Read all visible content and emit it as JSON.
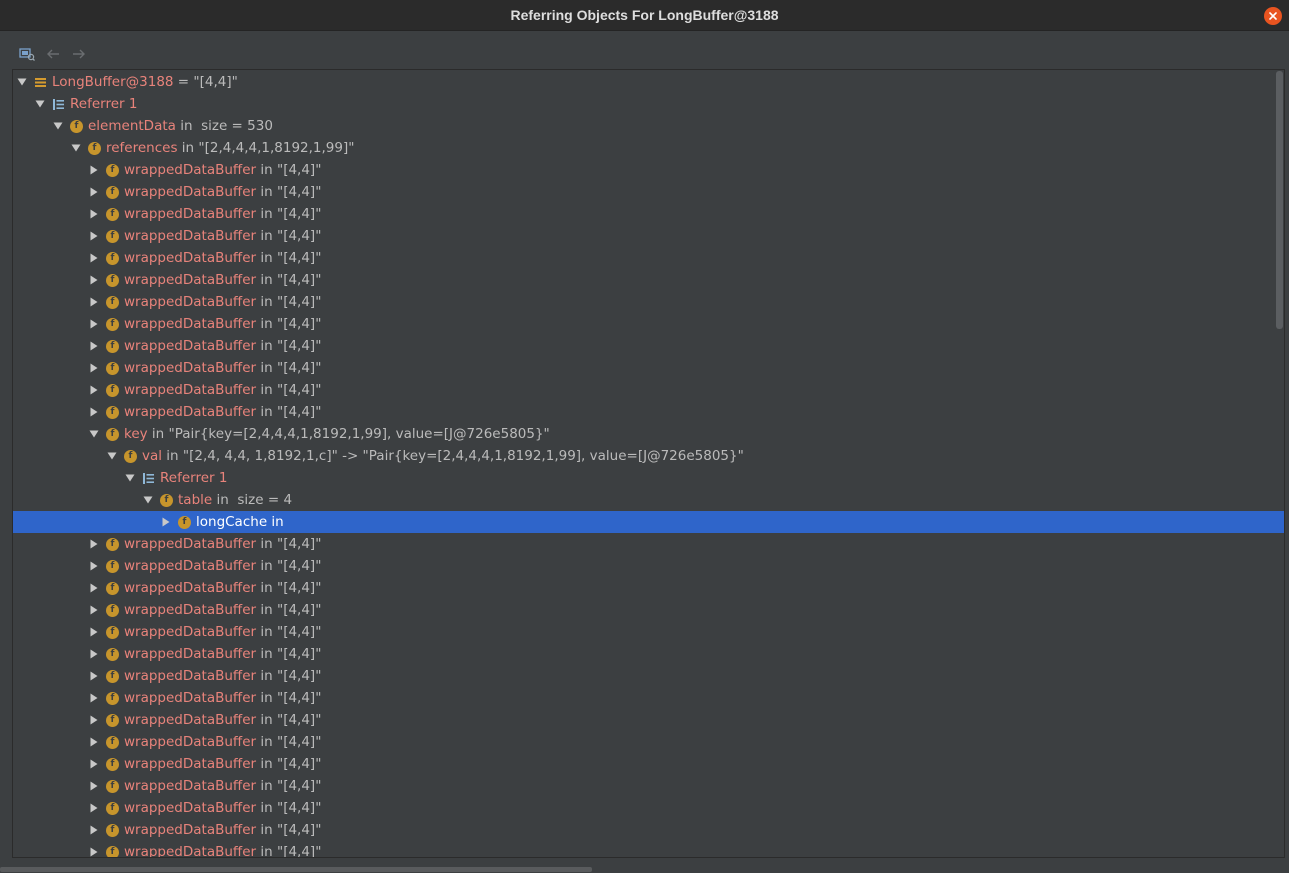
{
  "window": {
    "title": "Referring Objects For LongBuffer@3188"
  },
  "toolbar": {
    "icons": [
      "filter-referrers-icon",
      "back-arrow-icon",
      "forward-arrow-icon"
    ]
  },
  "colors": {
    "background": "#3c3f41",
    "title_bar": "#2b2b2b",
    "close_button": "#e95420",
    "field_name": "#e8837b",
    "field_icon": "#c7952c",
    "selection": "#2f65ca",
    "text": "#bbbbbb"
  },
  "tree": {
    "rows": [
      {
        "depth": 0,
        "expanded": true,
        "icon": "object-icon",
        "name": "LongBuffer@3188",
        "rest": " = \"[4,4]\""
      },
      {
        "depth": 1,
        "expanded": true,
        "icon": "referrer-list-icon",
        "name": "Referrer 1",
        "rest": ""
      },
      {
        "depth": 2,
        "expanded": true,
        "icon": "field-icon",
        "name": "elementData",
        "rest": " in  size = 530"
      },
      {
        "depth": 3,
        "expanded": true,
        "icon": "field-icon",
        "name": "references",
        "rest": " in \"[2,4,4,4,1,8192,1,99]\""
      },
      {
        "depth": 4,
        "expanded": false,
        "icon": "field-icon",
        "name": "wrappedDataBuffer",
        "rest": " in \"[4,4]\""
      },
      {
        "depth": 4,
        "expanded": false,
        "icon": "field-icon",
        "name": "wrappedDataBuffer",
        "rest": " in \"[4,4]\""
      },
      {
        "depth": 4,
        "expanded": false,
        "icon": "field-icon",
        "name": "wrappedDataBuffer",
        "rest": " in \"[4,4]\""
      },
      {
        "depth": 4,
        "expanded": false,
        "icon": "field-icon",
        "name": "wrappedDataBuffer",
        "rest": " in \"[4,4]\""
      },
      {
        "depth": 4,
        "expanded": false,
        "icon": "field-icon",
        "name": "wrappedDataBuffer",
        "rest": " in \"[4,4]\""
      },
      {
        "depth": 4,
        "expanded": false,
        "icon": "field-icon",
        "name": "wrappedDataBuffer",
        "rest": " in \"[4,4]\""
      },
      {
        "depth": 4,
        "expanded": false,
        "icon": "field-icon",
        "name": "wrappedDataBuffer",
        "rest": " in \"[4,4]\""
      },
      {
        "depth": 4,
        "expanded": false,
        "icon": "field-icon",
        "name": "wrappedDataBuffer",
        "rest": " in \"[4,4]\""
      },
      {
        "depth": 4,
        "expanded": false,
        "icon": "field-icon",
        "name": "wrappedDataBuffer",
        "rest": " in \"[4,4]\""
      },
      {
        "depth": 4,
        "expanded": false,
        "icon": "field-icon",
        "name": "wrappedDataBuffer",
        "rest": " in \"[4,4]\""
      },
      {
        "depth": 4,
        "expanded": false,
        "icon": "field-icon",
        "name": "wrappedDataBuffer",
        "rest": " in \"[4,4]\""
      },
      {
        "depth": 4,
        "expanded": false,
        "icon": "field-icon",
        "name": "wrappedDataBuffer",
        "rest": " in \"[4,4]\""
      },
      {
        "depth": 4,
        "expanded": true,
        "icon": "field-icon",
        "name": "key",
        "rest": " in \"Pair{key=[2,4,4,4,1,8192,1,99], value=[J@726e5805}\""
      },
      {
        "depth": 5,
        "expanded": true,
        "icon": "field-icon",
        "name": "val",
        "rest": " in \"[2,4, 4,4, 1,8192,1,c]\" -> \"Pair{key=[2,4,4,4,1,8192,1,99], value=[J@726e5805}\""
      },
      {
        "depth": 6,
        "expanded": true,
        "icon": "referrer-list-icon",
        "name": "Referrer 1",
        "rest": ""
      },
      {
        "depth": 7,
        "expanded": true,
        "icon": "field-icon",
        "name": "table",
        "rest": " in  size = 4"
      },
      {
        "depth": 8,
        "expanded": false,
        "icon": "field-icon",
        "name": "longCache",
        "rest": " in",
        "selected": true
      },
      {
        "depth": 4,
        "expanded": false,
        "icon": "field-icon",
        "name": "wrappedDataBuffer",
        "rest": " in \"[4,4]\""
      },
      {
        "depth": 4,
        "expanded": false,
        "icon": "field-icon",
        "name": "wrappedDataBuffer",
        "rest": " in \"[4,4]\""
      },
      {
        "depth": 4,
        "expanded": false,
        "icon": "field-icon",
        "name": "wrappedDataBuffer",
        "rest": " in \"[4,4]\""
      },
      {
        "depth": 4,
        "expanded": false,
        "icon": "field-icon",
        "name": "wrappedDataBuffer",
        "rest": " in \"[4,4]\""
      },
      {
        "depth": 4,
        "expanded": false,
        "icon": "field-icon",
        "name": "wrappedDataBuffer",
        "rest": " in \"[4,4]\""
      },
      {
        "depth": 4,
        "expanded": false,
        "icon": "field-icon",
        "name": "wrappedDataBuffer",
        "rest": " in \"[4,4]\""
      },
      {
        "depth": 4,
        "expanded": false,
        "icon": "field-icon",
        "name": "wrappedDataBuffer",
        "rest": " in \"[4,4]\""
      },
      {
        "depth": 4,
        "expanded": false,
        "icon": "field-icon",
        "name": "wrappedDataBuffer",
        "rest": " in \"[4,4]\""
      },
      {
        "depth": 4,
        "expanded": false,
        "icon": "field-icon",
        "name": "wrappedDataBuffer",
        "rest": " in \"[4,4]\""
      },
      {
        "depth": 4,
        "expanded": false,
        "icon": "field-icon",
        "name": "wrappedDataBuffer",
        "rest": " in \"[4,4]\""
      },
      {
        "depth": 4,
        "expanded": false,
        "icon": "field-icon",
        "name": "wrappedDataBuffer",
        "rest": " in \"[4,4]\""
      },
      {
        "depth": 4,
        "expanded": false,
        "icon": "field-icon",
        "name": "wrappedDataBuffer",
        "rest": " in \"[4,4]\""
      },
      {
        "depth": 4,
        "expanded": false,
        "icon": "field-icon",
        "name": "wrappedDataBuffer",
        "rest": " in \"[4,4]\""
      },
      {
        "depth": 4,
        "expanded": false,
        "icon": "field-icon",
        "name": "wrappedDataBuffer",
        "rest": " in \"[4,4]\""
      },
      {
        "depth": 4,
        "expanded": false,
        "icon": "field-icon",
        "name": "wrappedDataBuffer",
        "rest": " in \"[4,4]\""
      }
    ]
  }
}
